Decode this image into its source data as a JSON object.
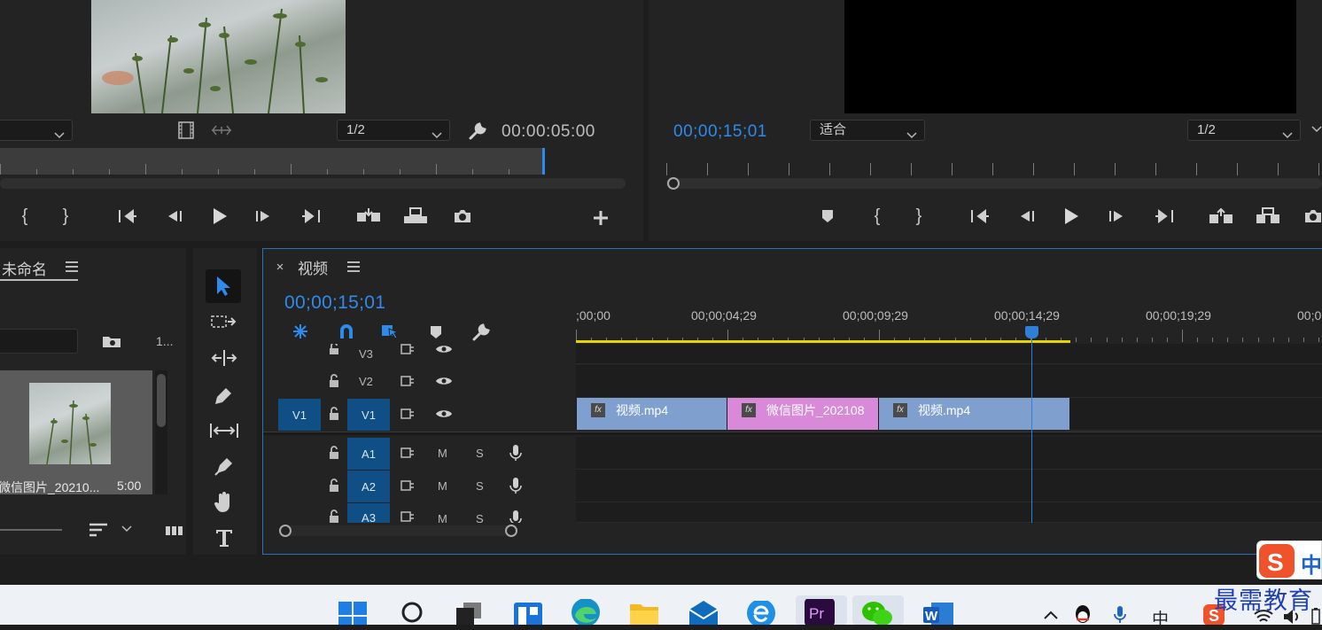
{
  "source_monitor": {
    "zoom": "1/2",
    "duration": "00:00:05:00"
  },
  "program_monitor": {
    "timecode": "00;00;15;01",
    "fit": "适合",
    "zoom": "1/2"
  },
  "project_panel": {
    "title": "未命名",
    "count": "1...",
    "item_name": "微信图片_20210...",
    "item_duration": "5:00"
  },
  "timeline": {
    "tab_title": "视频",
    "timecode": "00;00;15;01",
    "ruler_labels": [
      ";00;00",
      "00;00;04;29",
      "00;00;09;29",
      "00;00;14;29",
      "00;00;19;29",
      "00;0"
    ],
    "tracks": {
      "v3": "V3",
      "v2": "V2",
      "v1_src": "V1",
      "v1": "V1",
      "a1": "A1",
      "a2": "A2",
      "a3": "A3",
      "mute": "M",
      "solo": "S"
    },
    "clips": [
      {
        "name": "视频.mp4",
        "color": "#7fa0cf"
      },
      {
        "name": "微信图片_202108",
        "color": "#d88ad8"
      },
      {
        "name": "视频.mp4",
        "color": "#7fa0cf"
      }
    ]
  },
  "taskbar": {
    "ime": "中",
    "brand": "最需教育",
    "sogou_label": "中"
  },
  "colors": {
    "accent": "#2d8ceb",
    "playhead": "#2f7fd8",
    "work_area": "#e6d400"
  }
}
